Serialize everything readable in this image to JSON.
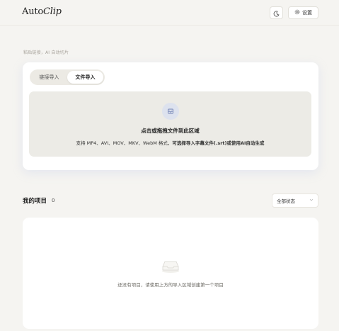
{
  "header": {
    "brand_prefix": "Auto",
    "brand_suffix": "Clip",
    "settings_label": "设置"
  },
  "hint": "粘贴链接，AI 自动切片",
  "import": {
    "tabs": [
      {
        "label": "链接导入",
        "active": false
      },
      {
        "label": "文件导入",
        "active": true
      }
    ],
    "dropzone": {
      "title": "点击或拖拽文件到此区域",
      "desc_plain": "支持 MP4、AVI、MOV、MKV、WebM 格式，",
      "desc_bold": "可选择导入字幕文件(.srt)或使用AI自动生成"
    }
  },
  "projects": {
    "title": "我的项目",
    "count": "0",
    "filter_value": "全部状态",
    "empty_text": "还没有项目，请使用上方的导入区域创建第一个项目"
  }
}
